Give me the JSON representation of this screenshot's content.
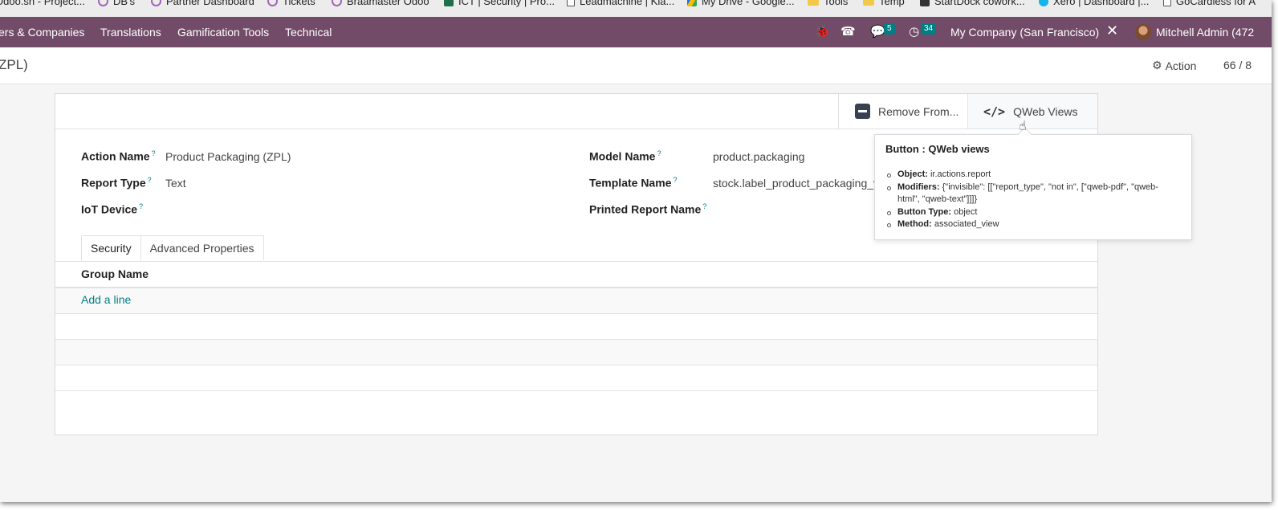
{
  "bookmarks": [
    {
      "label": "Odoo.sh - Project...",
      "icon": "odoo-icon"
    },
    {
      "label": "DB's",
      "icon": "circle-icon"
    },
    {
      "label": "Partner Dashboard",
      "icon": "circle-icon"
    },
    {
      "label": "Tickets",
      "icon": "circle-icon"
    },
    {
      "label": "Braamaster Odoo",
      "icon": "circle-icon"
    },
    {
      "label": "ICT | Security | Pro...",
      "icon": "ict-icon"
    },
    {
      "label": "Leadmachine | Kla...",
      "icon": "doc-icon"
    },
    {
      "label": "My Drive - Google...",
      "icon": "drive-icon"
    },
    {
      "label": "Tools",
      "icon": "folder-icon"
    },
    {
      "label": "Temp",
      "icon": "folder-icon"
    },
    {
      "label": "StartDock cowork...",
      "icon": "startdock-icon"
    },
    {
      "label": "Xero | Dashboard |...",
      "icon": "xero-icon"
    },
    {
      "label": "GoCardless for A",
      "icon": "doc-icon"
    }
  ],
  "navbar": {
    "menus": [
      "ers & Companies",
      "Translations",
      "Gamification Tools",
      "Technical"
    ],
    "messages_count": "5",
    "activities_count": "34",
    "company": "My Company (San Francisco)",
    "user": "Mitchell Admin (472"
  },
  "control_panel": {
    "breadcrumb": "ZPL)",
    "action_label": "Action",
    "pager": "66 / 8"
  },
  "stat_buttons": {
    "remove_label": "Remove From...",
    "qweb_label": "QWeb Views"
  },
  "fields": {
    "action_name": {
      "label": "Action Name",
      "value": "Product Packaging (ZPL)"
    },
    "report_type": {
      "label": "Report Type",
      "value": "Text"
    },
    "iot_device": {
      "label": "IoT Device",
      "value": ""
    },
    "model_name": {
      "label": "Model Name",
      "value": "product.packaging"
    },
    "template_name": {
      "label": "Template Name",
      "value": "stock.label_product_packaging_v"
    },
    "printed_report_name": {
      "label": "Printed Report Name",
      "value": ""
    },
    "help_mark": "?"
  },
  "tabs": [
    {
      "label": "Security",
      "active": true
    },
    {
      "label": "Advanced Properties",
      "active": false
    }
  ],
  "security_list": {
    "column": "Group Name",
    "add_line": "Add a line"
  },
  "tooltip": {
    "title": "Button : QWeb views",
    "items": [
      {
        "key": "Object:",
        "value": "ir.actions.report"
      },
      {
        "key": "Modifiers:",
        "value": "{\"invisible\": [[\"report_type\", \"not in\", [\"qweb-pdf\", \"qweb-html\", \"qweb-text\"]]]}"
      },
      {
        "key": "Button Type:",
        "value": "object"
      },
      {
        "key": "Method:",
        "value": "associated_view"
      }
    ]
  },
  "colors": {
    "navbar": "#714b67",
    "accent": "#017e84",
    "background": "#f5f5f6"
  }
}
